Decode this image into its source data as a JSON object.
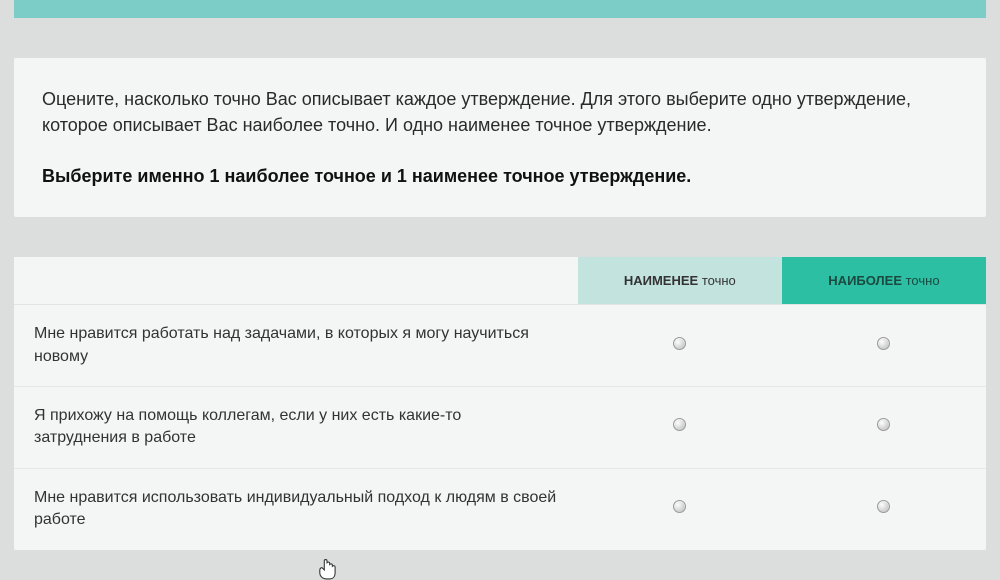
{
  "instructions": {
    "paragraph": "Оцените, насколько точно Вас описывает каждое утверждение. Для этого выберите одно утверждение, которое описывает Вас наиболее точно. И одно наименее точное утверждение.",
    "bold": "Выберите именно 1 наиболее точное и 1 наименее точное утверждение."
  },
  "headers": {
    "least_strong": "НАИМЕНЕЕ",
    "least_light": " точно",
    "most_strong": "НАИБОЛЕЕ",
    "most_light": " точно"
  },
  "statements": [
    "Мне нравится работать над задачами, в которых я могу научиться новому",
    "Я прихожу на помощь коллегам, если у них есть какие-то затруднения в работе",
    "Мне нравится использовать индивидуальный подход к людям в своей работе"
  ]
}
